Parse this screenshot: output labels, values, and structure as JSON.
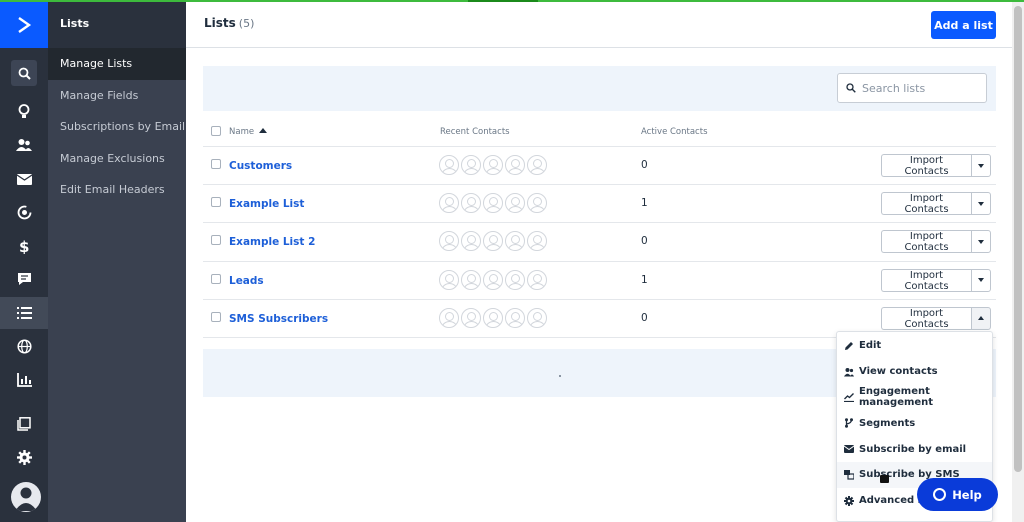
{
  "colors": {
    "brand": "#0a5aff",
    "link": "#1d5fd8",
    "rail_bg": "#2a313d",
    "submenu_bg": "#3a4150",
    "help_bg": "#0a3bd9"
  },
  "rail": {
    "icons": [
      "logo-chevron-icon",
      "search-icon",
      "lightbulb-icon",
      "contacts-icon",
      "envelope-icon",
      "automations-icon",
      "dollar-icon",
      "conversations-icon",
      "list-icon",
      "globe-icon",
      "chart-icon",
      "pages-icon",
      "gear-icon",
      "avatar-icon"
    ]
  },
  "submenu": {
    "title": "Lists",
    "items": [
      {
        "label": "Manage Lists",
        "active": true
      },
      {
        "label": "Manage Fields"
      },
      {
        "label": "Subscriptions by Email"
      },
      {
        "label": "Manage Exclusions"
      },
      {
        "label": "Edit Email Headers"
      }
    ]
  },
  "header": {
    "title": "Lists",
    "count": "(5)",
    "add_button": "Add a list"
  },
  "search": {
    "placeholder": "Search lists",
    "value": ""
  },
  "table": {
    "columns": [
      "Name",
      "Recent Contacts",
      "Active Contacts"
    ],
    "rows": [
      {
        "name": "Customers",
        "active": "0",
        "action": "Import Contacts"
      },
      {
        "name": "Example List",
        "active": "1",
        "action": "Import Contacts"
      },
      {
        "name": "Example List 2",
        "active": "0",
        "action": "Import Contacts"
      },
      {
        "name": "Leads",
        "active": "1",
        "action": "Import Contacts"
      },
      {
        "name": "SMS Subscribers",
        "active": "0",
        "action": "Import Contacts"
      }
    ]
  },
  "dropdown": {
    "items": [
      {
        "label": "Edit",
        "icon": "pencil-icon"
      },
      {
        "label": "View contacts",
        "icon": "contacts-icon"
      },
      {
        "label": "Engagement management",
        "icon": "trend-icon"
      },
      {
        "label": "Segments",
        "icon": "segments-icon"
      },
      {
        "label": "Subscribe by email",
        "icon": "envelope-icon"
      },
      {
        "label": "Subscribe by SMS",
        "icon": "sms-icon"
      },
      {
        "label": "Advanced se",
        "icon": "gear-icon"
      }
    ]
  },
  "help": {
    "label": "Help"
  }
}
